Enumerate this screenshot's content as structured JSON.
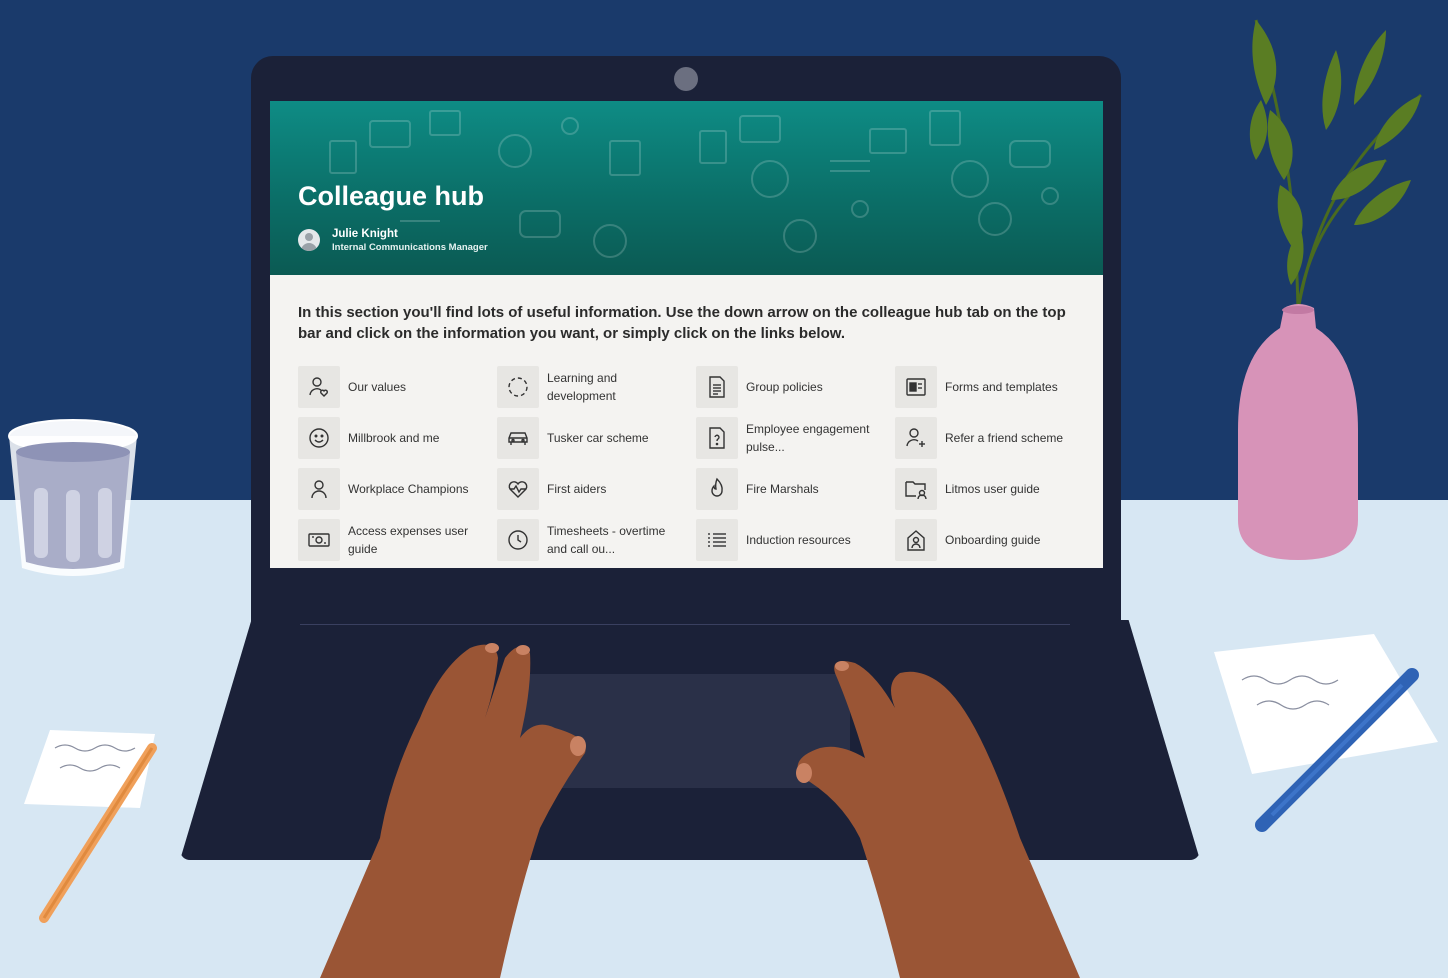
{
  "page": {
    "title": "Colleague hub",
    "author": {
      "name": "Julie Knight",
      "role": "Internal Communications Manager"
    },
    "intro": "In this section you'll find lots of useful information. Use the down arrow on the colleague hub tab on the top bar and click on the information you want, or simply click on the links below."
  },
  "colors": {
    "wall": "#1a3a6b",
    "desk": "#d7e7f3",
    "hero": "#0b6f68",
    "laptop": "#1b2138"
  },
  "links": [
    {
      "label": "Our values",
      "icon": "person-heart-icon"
    },
    {
      "label": "Learning and development",
      "icon": "dashed-circle-icon"
    },
    {
      "label": "Group policies",
      "icon": "document-icon"
    },
    {
      "label": "Forms and templates",
      "icon": "forms-icon"
    },
    {
      "label": "Millbrook and me",
      "icon": "smiley-icon"
    },
    {
      "label": "Tusker car scheme",
      "icon": "car-icon"
    },
    {
      "label": "Employee engagement pulse...",
      "icon": "document-question-icon"
    },
    {
      "label": "Refer a friend scheme",
      "icon": "person-add-icon"
    },
    {
      "label": "Workplace Champions",
      "icon": "person-icon"
    },
    {
      "label": "First aiders",
      "icon": "heart-pulse-icon"
    },
    {
      "label": "Fire Marshals",
      "icon": "flame-icon"
    },
    {
      "label": "Litmos user guide",
      "icon": "folder-person-icon"
    },
    {
      "label": "Access expenses user guide",
      "icon": "money-icon"
    },
    {
      "label": "Timesheets - overtime and call ou...",
      "icon": "clock-icon"
    },
    {
      "label": "Induction resources",
      "icon": "list-icon"
    },
    {
      "label": "Onboarding guide",
      "icon": "contact-card-icon"
    }
  ]
}
